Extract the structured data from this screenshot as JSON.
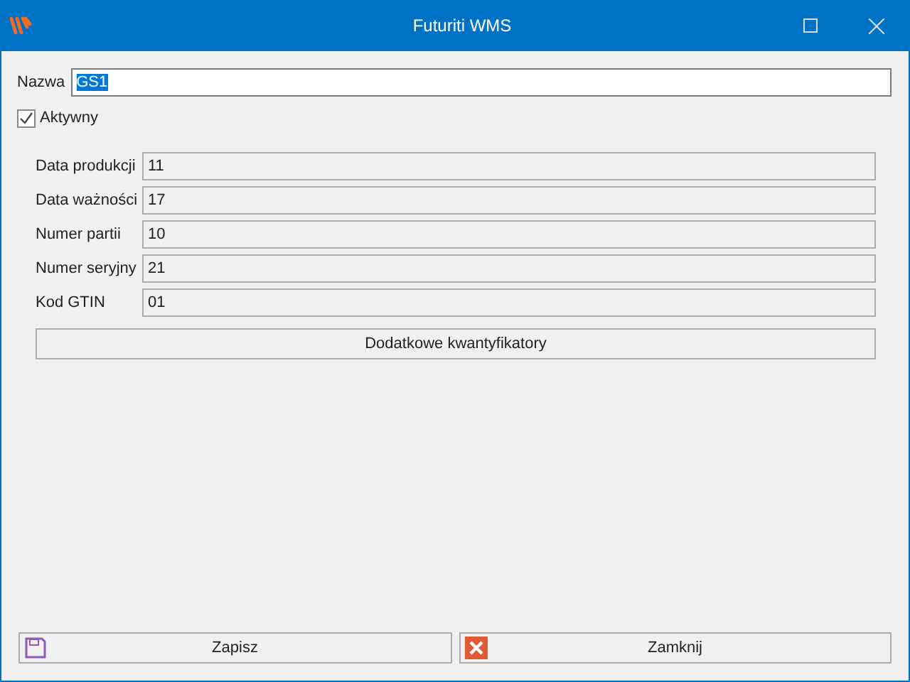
{
  "window": {
    "title": "Futuriti WMS"
  },
  "name_field": {
    "label": "Nazwa",
    "value": "GS1",
    "text_selected": true
  },
  "active_checkbox": {
    "label": "Aktywny",
    "checked": true
  },
  "fields": [
    {
      "label": "Data produkcji",
      "value": "11"
    },
    {
      "label": "Data ważności",
      "value": "17"
    },
    {
      "label": "Numer partii",
      "value": "10"
    },
    {
      "label": "Numer seryjny",
      "value": "21"
    },
    {
      "label": "Kod GTIN",
      "value": "01"
    }
  ],
  "extra_button": {
    "label": "Dodatkowe kwantyfikatory"
  },
  "buttons": [
    {
      "label": "Zapisz",
      "kind": "save"
    },
    {
      "label": "Zamknij",
      "kind": "close"
    }
  ]
}
